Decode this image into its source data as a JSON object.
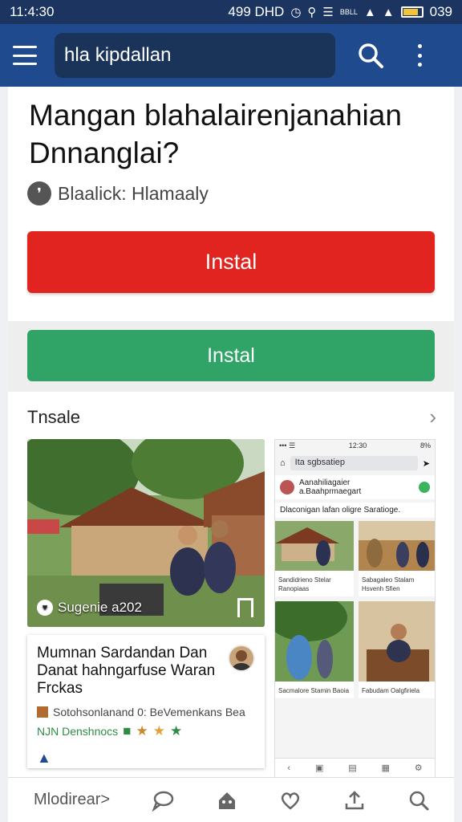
{
  "status_bar": {
    "time": "11:4:30",
    "left_info": "499 DHD",
    "battery_text": "039",
    "network_label": "BBLL"
  },
  "app_bar": {
    "search_value": "hla kipdallan"
  },
  "article": {
    "title": "Mangan blahalairenjanahian Dnnanglai?",
    "author": "Blaalick: Hlamaaly"
  },
  "buttons": {
    "primary_label": "Instal",
    "secondary_label": "Instal"
  },
  "section": {
    "heading": "Tnsale"
  },
  "photo_card": {
    "caption": "Sugenie a202"
  },
  "mini_screenshot": {
    "status_time": "12:30",
    "status_battery": "8%",
    "search_text": "Ita sgbsatiep",
    "profile_line": "Aanahiliagaier a.Baahprmaegart",
    "post_line": "Dlaconigan lafan oligre Saratioge.",
    "tile1_caption": "Sandidrieno Stelar Ranopiaas",
    "tile2_caption": "Sabagaleo Stalam Hsvenh Sfien",
    "tile3_caption": "Sacmalore Stamin Baoia",
    "tile4_caption": "Fabudam Oalgfiriela"
  },
  "article_card": {
    "headline": "Mumnan Sardandan Dan Danat hahngarfuse Waran Frckas",
    "meta": "Sotohsonlanand 0: BeVemenkans Bea",
    "tags": "NJN Denshnocs"
  },
  "bottom_nav": {
    "first_label": "Mlodirear>"
  },
  "icons": {
    "menu": "menu-icon",
    "search": "search-icon",
    "more": "more-vert-icon",
    "chevron": "chevron-right-icon",
    "bookmark": "bookmark-icon",
    "chat": "chat-icon",
    "home": "home-icon",
    "heart": "heart-icon",
    "upload": "upload-icon"
  },
  "colors": {
    "app_bar": "#1f4b8e",
    "status_bar": "#1b3560",
    "primary_button": "#e22421",
    "secondary_button": "#2fa466"
  }
}
